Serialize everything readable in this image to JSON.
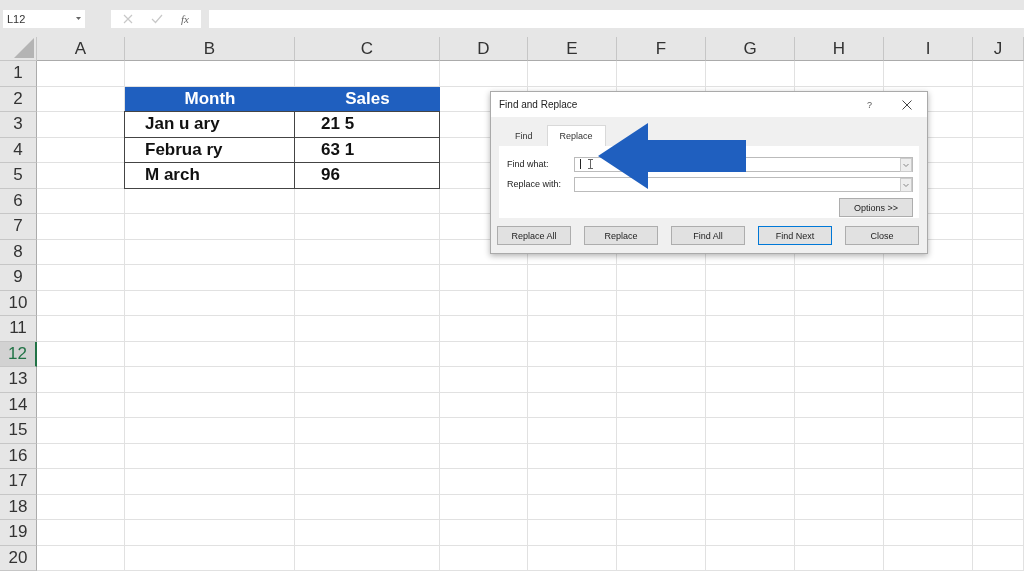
{
  "formula_bar": {
    "name_box": "L12",
    "function_label": "fx"
  },
  "sheet": {
    "columns": [
      {
        "label": "A",
        "selected": false
      },
      {
        "label": "B",
        "selected": false
      },
      {
        "label": "C",
        "selected": false
      },
      {
        "label": "D",
        "selected": false
      },
      {
        "label": "E",
        "selected": false
      },
      {
        "label": "F",
        "selected": false
      },
      {
        "label": "G",
        "selected": false
      },
      {
        "label": "H",
        "selected": false
      },
      {
        "label": "I",
        "selected": false
      },
      {
        "label": "J",
        "selected": false
      }
    ],
    "rows": [
      {
        "label": "1",
        "selected": false
      },
      {
        "label": "2",
        "selected": false
      },
      {
        "label": "3",
        "selected": false
      },
      {
        "label": "4",
        "selected": false
      },
      {
        "label": "5",
        "selected": false
      },
      {
        "label": "6",
        "selected": false
      },
      {
        "label": "7",
        "selected": false
      },
      {
        "label": "8",
        "selected": false
      },
      {
        "label": "9",
        "selected": false
      },
      {
        "label": "10",
        "selected": false
      },
      {
        "label": "11",
        "selected": false
      },
      {
        "label": "12",
        "selected": true
      },
      {
        "label": "13",
        "selected": false
      },
      {
        "label": "14",
        "selected": false
      },
      {
        "label": "15",
        "selected": false
      },
      {
        "label": "16",
        "selected": false
      },
      {
        "label": "17",
        "selected": false
      },
      {
        "label": "18",
        "selected": false
      },
      {
        "label": "19",
        "selected": false
      },
      {
        "label": "20",
        "selected": false
      }
    ],
    "table": {
      "header": [
        "Month",
        "Sales"
      ],
      "rows": [
        [
          "Jan u ary",
          "21 5"
        ],
        [
          "Februa ry",
          "63 1"
        ],
        [
          "M arch",
          "96"
        ]
      ]
    }
  },
  "dialog": {
    "title": "Find and Replace",
    "help": "?",
    "tabs": [
      {
        "label": "Find",
        "selected": false
      },
      {
        "label": "Replace",
        "selected": true
      }
    ],
    "fields": [
      {
        "label": "Find what:",
        "focused": true
      },
      {
        "label": "Replace with:",
        "focused": false
      }
    ],
    "options_button": "Options >>",
    "buttons": [
      {
        "label": "Replace All",
        "default": false
      },
      {
        "label": "Replace",
        "default": false
      },
      {
        "label": "Find All",
        "default": false
      },
      {
        "label": "Find Next",
        "default": true
      },
      {
        "label": "Close",
        "default": false
      }
    ]
  }
}
